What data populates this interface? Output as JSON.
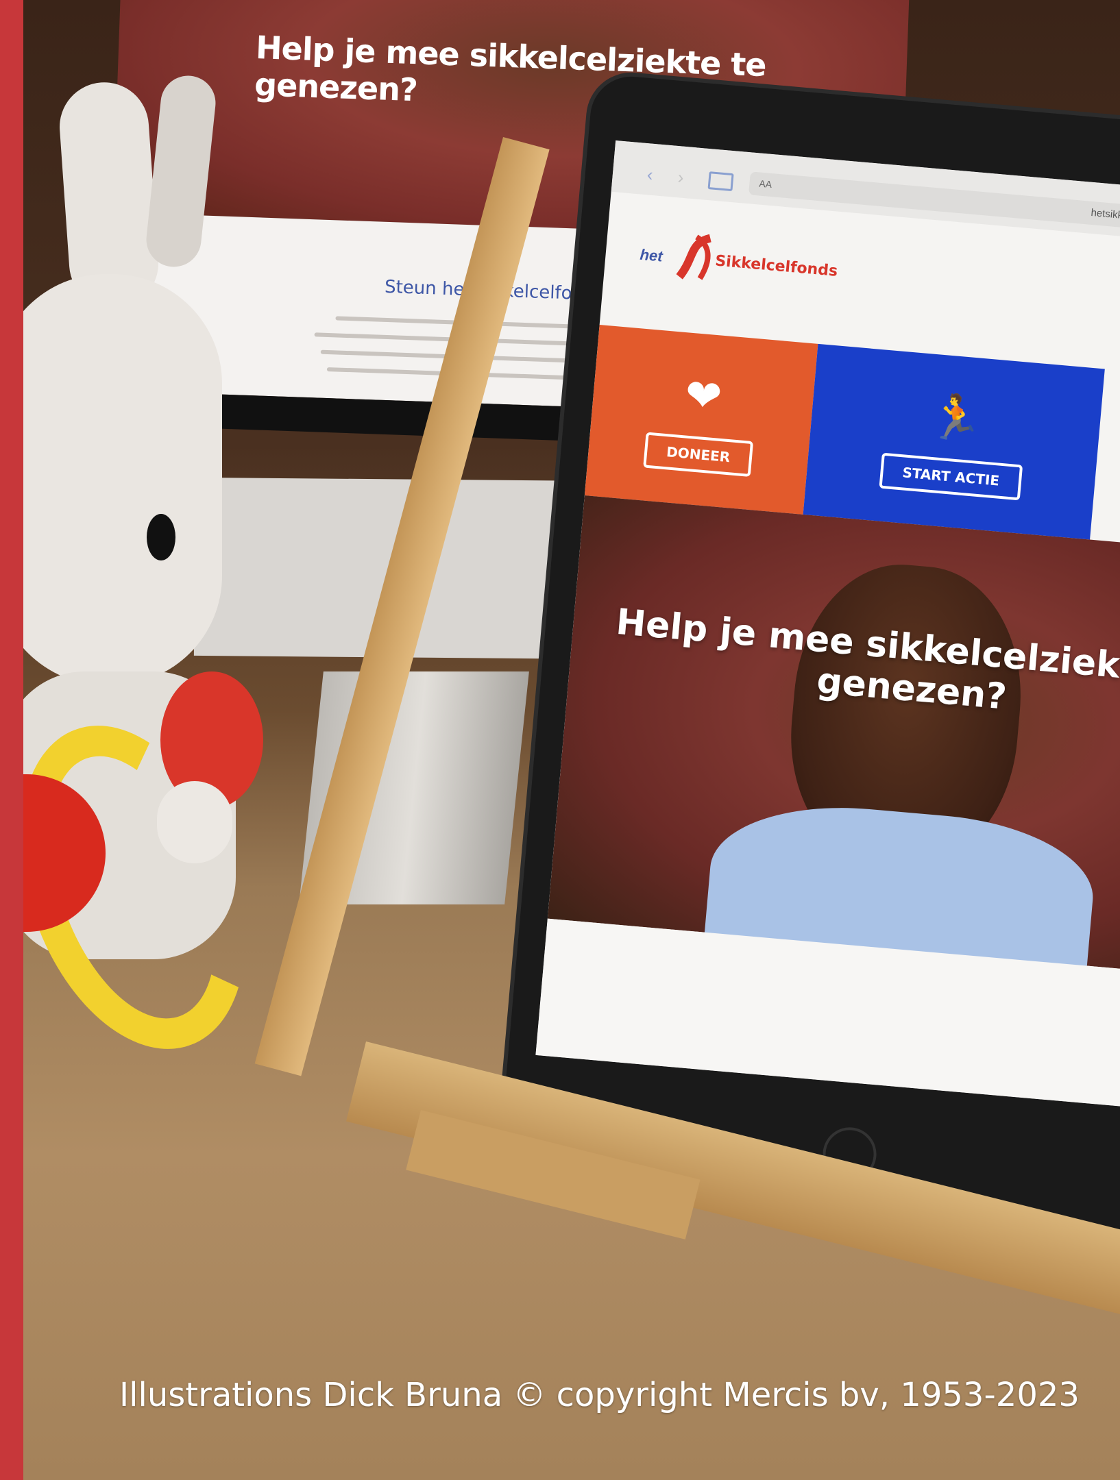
{
  "monitor": {
    "hero_text": "Help je mee sikkelcelziekte te genezen?",
    "page_title": "Steun het Sikkelcelfonds"
  },
  "tablet": {
    "logo_het": "het",
    "logo_name": "Sikkelcelfonds",
    "url_partial": "hetsikkelcelfonds",
    "url_aa": "AA",
    "tiles": [
      {
        "label": "DONEER",
        "icon": "heart-hand-icon",
        "color": "#e25a2c"
      },
      {
        "label": "START ACTIE",
        "icon": "running-person-icon",
        "color": "#1a3fc9"
      }
    ],
    "hero_text": "Help je mee sikkelcelziekte te genezen?"
  },
  "copyright": "Illustrations Dick Bruna © copyright Mercis bv, 1953-2023",
  "colors": {
    "side_strip": "#c7373a",
    "brand_blue": "#3d56a6",
    "brand_red": "#d8362b"
  }
}
